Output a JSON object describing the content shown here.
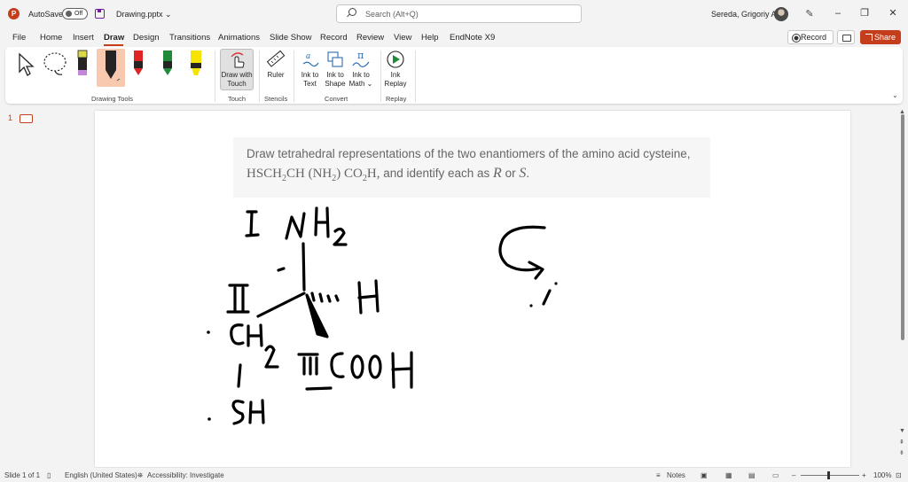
{
  "titlebar": {
    "app_logo": "P",
    "autosave_label": "AutoSave",
    "autosave_state": "Off",
    "filename": "Drawing.pptx",
    "search_placeholder": "Search (Alt+Q)",
    "user_name": "Sereda, Grigoriy A",
    "minimize": "–",
    "restore": "❐",
    "close": "✕"
  },
  "menu": {
    "tabs": [
      "File",
      "Home",
      "Insert",
      "Draw",
      "Design",
      "Transitions",
      "Animations",
      "Slide Show",
      "Record",
      "Review",
      "View",
      "Help",
      "EndNote X9"
    ],
    "active_tab": "Draw",
    "record_label": "Record",
    "share_label": "Share"
  },
  "ribbon": {
    "groups": {
      "drawing_tools": "Drawing Tools",
      "touch": "Touch",
      "stencils": "Stencils",
      "convert": "Convert",
      "replay": "Replay"
    },
    "draw_with_touch": [
      "Draw with",
      "Touch"
    ],
    "ruler": "Ruler",
    "ink_to_text": [
      "Ink to",
      "Text"
    ],
    "ink_to_shape": [
      "Ink to",
      "Shape"
    ],
    "ink_to_math": [
      "Ink to",
      "Math ⌄"
    ],
    "ink_replay": [
      "Ink",
      "Replay"
    ],
    "pen_colors": [
      "#d9d94a",
      "#1a1a1a",
      "#e02424",
      "#1f8a3a",
      "#f5e400"
    ]
  },
  "thumbnails": {
    "slide_number": "1"
  },
  "slide": {
    "question_line1": "Draw tetrahedral representations of the two enantiomers of the amino acid cysteine,",
    "formula": "HSCH₂CH (NH₂) CO₂H,",
    "question_line2_text": "and identify each as",
    "config_r": "R",
    "or_text": "or",
    "config_s": "S",
    "period": "."
  },
  "statusbar": {
    "slide_info": "Slide 1 of 1",
    "language": "English (United States)",
    "accessibility": "Accessibility: Investigate",
    "notes": "Notes",
    "zoom": "100%",
    "zoom_minus": "–",
    "zoom_plus": "+"
  }
}
